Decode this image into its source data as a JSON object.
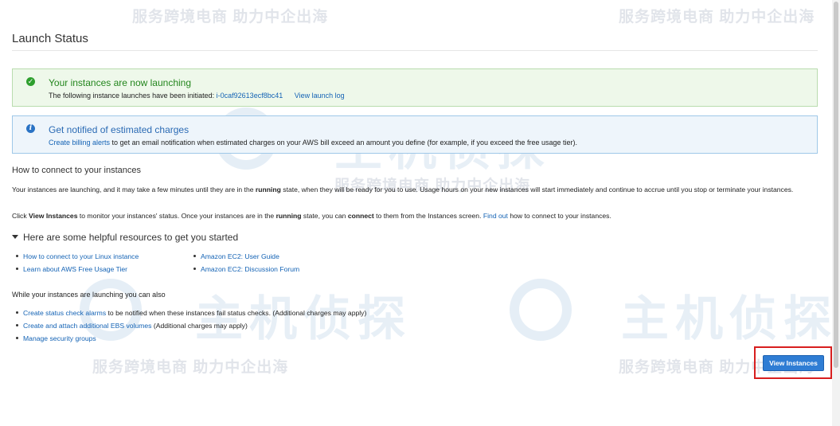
{
  "page": {
    "title": "Launch Status"
  },
  "success_alert": {
    "heading": "Your instances are now launching",
    "text": "The following instance launches have been initiated:",
    "instance_id": "i-0caf92613ecf8bc41",
    "log_link": "View launch log"
  },
  "info_alert": {
    "heading": "Get notified of estimated charges",
    "link": "Create billing alerts",
    "text": " to get an email notification when estimated charges on your AWS bill exceed an amount you define (for example, if you exceed the free usage tier)."
  },
  "connect": {
    "title": "How to connect to your instances",
    "p1_a": "Your instances are launching, and it may take a few minutes until they are in the ",
    "p1_b": "running",
    "p1_c": " state, when they will be ready for you to use. Usage hours on your new instances will start immediately and continue to accrue until you stop or terminate your instances.",
    "p2_a": "Click ",
    "p2_b": "View Instances",
    "p2_c": " to monitor your instances' status. Once your instances are in the ",
    "p2_d": "running",
    "p2_e": " state, you can ",
    "p2_f": "connect",
    "p2_g": " to them from the Instances screen. ",
    "p2_link": "Find out",
    "p2_h": " how to connect to your instances."
  },
  "resources": {
    "title": "Here are some helpful resources to get you started",
    "left": [
      "How to connect to your Linux instance",
      "Learn about AWS Free Usage Tier"
    ],
    "right": [
      "Amazon EC2: User Guide",
      "Amazon EC2: Discussion Forum"
    ]
  },
  "while": {
    "title": "While your instances are launching you can also",
    "items": [
      {
        "link": "Create status check alarms",
        "text": " to be notified when these instances fail status checks. (Additional charges may apply)"
      },
      {
        "link": "Create and attach additional EBS volumes",
        "text": " (Additional charges may apply)"
      },
      {
        "link": "Manage security groups",
        "text": ""
      }
    ]
  },
  "actions": {
    "view_instances": "View Instances"
  },
  "watermark": {
    "slogan": "服务跨境电商 助力中企出海",
    "brand": "主机侦探"
  }
}
